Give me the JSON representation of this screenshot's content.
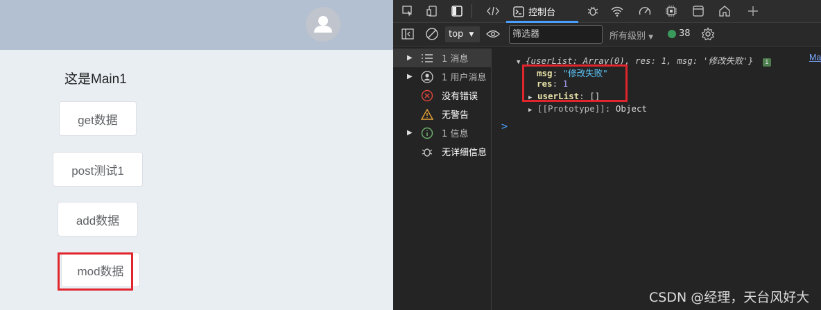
{
  "app": {
    "title": "这是Main1",
    "buttons": {
      "get": "get数据",
      "post": "post测试1",
      "add": "add数据",
      "mod": "mod数据"
    }
  },
  "devtools": {
    "active_tab": "控制台",
    "toolbar": {
      "context": "top",
      "filter_placeholder": "筛选器",
      "levels": "所有级别",
      "message_count": "38"
    },
    "sidebar": [
      {
        "label": "1 消息",
        "icon": "list-icon"
      },
      {
        "label": "1 用户消息",
        "icon": "user-icon"
      },
      {
        "label": "没有错误",
        "icon": "error-icon"
      },
      {
        "label": "无警告",
        "icon": "warning-icon"
      },
      {
        "label": "1 信息",
        "icon": "info-icon"
      },
      {
        "label": "无详细信息",
        "icon": "verbose-icon"
      }
    ],
    "console": {
      "summary": "{userList: Array(0), res: 1, msg: '修改失败'}",
      "link": "Mai",
      "msg_key": "msg",
      "msg_val": "\"修改失败\"",
      "res_key": "res",
      "res_val": "1",
      "userlist_key": "userList",
      "userlist_val": "[]",
      "prototype_key": "[[Prototype]]",
      "prototype_val": "Object",
      "prompt": ">"
    }
  },
  "watermark": "CSDN @经理，天台风好大"
}
